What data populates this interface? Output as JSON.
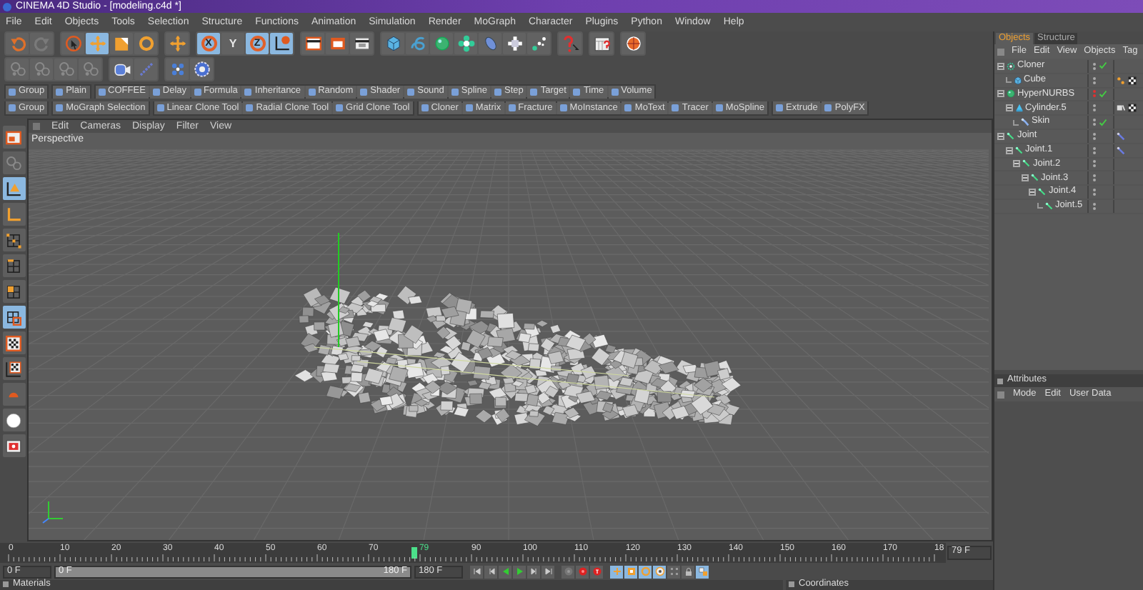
{
  "window": {
    "title": "CINEMA 4D Studio - [modeling.c4d *]"
  },
  "menu": [
    "File",
    "Edit",
    "Objects",
    "Tools",
    "Selection",
    "Structure",
    "Functions",
    "Animation",
    "Simulation",
    "Render",
    "MoGraph",
    "Character",
    "Plugins",
    "Python",
    "Window",
    "Help"
  ],
  "toolbar_rows": [
    [
      [
        {
          "kind": "undo",
          "selected": false
        },
        {
          "kind": "redo",
          "selected": false
        }
      ],
      [
        {
          "kind": "live-select",
          "selected": false
        },
        {
          "kind": "move",
          "selected": true
        },
        {
          "kind": "scale",
          "selected": false
        },
        {
          "kind": "rotate",
          "selected": false
        }
      ],
      [
        {
          "kind": "recent-tool",
          "selected": false
        }
      ],
      [
        {
          "kind": "axis",
          "label": "X",
          "selected": true
        },
        {
          "kind": "axis",
          "label": "Y",
          "selected": false
        },
        {
          "kind": "axis",
          "label": "Z",
          "selected": true
        },
        {
          "kind": "world-coords",
          "selected": true
        }
      ],
      [
        {
          "kind": "render-view",
          "selected": false
        },
        {
          "kind": "render-picture",
          "selected": false
        },
        {
          "kind": "render-settings",
          "selected": false
        }
      ],
      [
        {
          "kind": "cube",
          "selected": false
        },
        {
          "kind": "spline",
          "selected": false
        },
        {
          "kind": "nurbs",
          "selected": false
        },
        {
          "kind": "mograph",
          "selected": false
        },
        {
          "kind": "deformer",
          "selected": false
        },
        {
          "kind": "scene",
          "selected": false
        },
        {
          "kind": "environment",
          "selected": false
        }
      ],
      [
        {
          "kind": "help-cursor",
          "selected": false
        }
      ],
      [
        {
          "kind": "calendar-help",
          "selected": false
        }
      ],
      [
        {
          "kind": "ball",
          "selected": false
        }
      ]
    ],
    [
      [
        {
          "kind": "tool-disabled",
          "selected": false
        },
        {
          "kind": "tool-disabled",
          "selected": false
        },
        {
          "kind": "tool-disabled",
          "selected": false
        },
        {
          "kind": "tool-disabled",
          "selected": false
        }
      ],
      [
        {
          "kind": "camera",
          "selected": false
        },
        {
          "kind": "light-line",
          "selected": false
        }
      ],
      [
        {
          "kind": "cluster",
          "selected": false
        },
        {
          "kind": "gear",
          "selected": false
        }
      ]
    ]
  ],
  "palette_rows": [
    [
      [
        "Group"
      ],
      [
        "Plain"
      ],
      [
        "COFFEE",
        "Delay",
        "Formula",
        "Inheritance",
        "Random",
        "Shader",
        "Sound",
        "Spline",
        "Step",
        "Target",
        "Time",
        "Volume"
      ]
    ],
    [
      [
        "Group"
      ],
      [
        "MoGraph Selection"
      ],
      [
        "Linear Clone Tool",
        "Radial Clone Tool",
        "Grid Clone Tool"
      ],
      [
        "Cloner",
        "Matrix",
        "Fracture",
        "MoInstance",
        "MoText",
        "Tracer",
        "MoSpline"
      ],
      [
        "Extrude",
        "PolyFX"
      ]
    ]
  ],
  "left_toolbar": [
    {
      "kind": "render-region",
      "selected": false
    },
    {
      "kind": "model-disabled",
      "selected": false
    },
    {
      "kind": "object-axis",
      "selected": true
    },
    {
      "kind": "axis-tool",
      "selected": false
    },
    {
      "kind": "points",
      "selected": false
    },
    {
      "kind": "edges",
      "selected": false
    },
    {
      "kind": "polygons",
      "selected": false
    },
    {
      "kind": "uvw",
      "selected": true
    },
    {
      "kind": "texture",
      "selected": false
    },
    {
      "kind": "texture-axis",
      "selected": false
    },
    {
      "kind": "snap",
      "selected": false
    },
    {
      "kind": "light-ball",
      "selected": false
    },
    {
      "kind": "red-window",
      "selected": false
    }
  ],
  "viewport": {
    "menu": [
      "Edit",
      "Cameras",
      "Display",
      "Filter",
      "View"
    ],
    "label": "Perspective"
  },
  "timeline": {
    "ticks_before": [
      "0",
      "10",
      "20",
      "30",
      "40",
      "50",
      "60",
      "70"
    ],
    "ticks_after": [
      "90",
      "100",
      "110",
      "120",
      "130",
      "140",
      "150",
      "160",
      "170",
      "18"
    ],
    "marker": {
      "label": "79",
      "level": 0.439
    },
    "frame_field": "79 F"
  },
  "transport": {
    "start_field": "0 F",
    "range": {
      "start": "0 F",
      "end": "180 F",
      "level": 1
    },
    "end_field": "180 F",
    "buttons": [
      {
        "kind": "go-start"
      },
      {
        "kind": "prev-key"
      },
      {
        "kind": "play-back"
      },
      {
        "kind": "play"
      },
      {
        "kind": "next-key"
      },
      {
        "kind": "go-end"
      }
    ],
    "record": [
      {
        "kind": "record-off"
      },
      {
        "kind": "record"
      },
      {
        "kind": "autokey"
      }
    ],
    "key_tools": [
      {
        "kind": "key-move",
        "selected": true
      },
      {
        "kind": "key-scale",
        "selected": true
      },
      {
        "kind": "key-rotate",
        "selected": true
      },
      {
        "kind": "key-param",
        "selected": true
      },
      {
        "kind": "key-pla",
        "selected": false
      },
      {
        "kind": "key-lock",
        "selected": false
      },
      {
        "kind": "key-all",
        "selected": true
      }
    ]
  },
  "materials": {
    "title": "Materials"
  },
  "coordinates": {
    "title": "Coordinates"
  },
  "object_manager": {
    "tabs": [
      {
        "label": "Objects",
        "selected": true
      },
      {
        "label": "Structure",
        "selected": false
      }
    ],
    "menu": [
      "File",
      "Edit",
      "View",
      "Objects",
      "Tag"
    ],
    "objects": [
      {
        "name": "Cloner",
        "kind": "cloner",
        "expanded": true,
        "hidden": false,
        "enabled": true,
        "children": [
          {
            "name": "Cube",
            "kind": "cube",
            "hidden": false,
            "tags": [
              {
                "kind": "phong"
              },
              {
                "kind": "material"
              }
            ]
          }
        ]
      },
      {
        "name": "HyperNURBS",
        "kind": "nurbs",
        "expanded": true,
        "hidden": true,
        "enabled": true,
        "children": [
          {
            "name": "Cylinder.5",
            "kind": "cylinder",
            "expanded": true,
            "hidden": false,
            "tags": [
              {
                "kind": "fixation"
              },
              {
                "kind": "material"
              }
            ],
            "children": [
              {
                "name": "Skin",
                "kind": "skin",
                "hidden": false,
                "enabled": true
              }
            ]
          }
        ]
      },
      {
        "name": "Joint",
        "kind": "joint",
        "expanded": true,
        "hidden": false,
        "tags": [
          {
            "kind": "ik"
          }
        ],
        "children": [
          {
            "name": "Joint.1",
            "kind": "joint",
            "expanded": true,
            "hidden": false,
            "tags": [
              {
                "kind": "ik"
              }
            ],
            "children": [
              {
                "name": "Joint.2",
                "kind": "joint",
                "expanded": true,
                "hidden": false,
                "children": [
                  {
                    "name": "Joint.3",
                    "kind": "joint",
                    "expanded": true,
                    "hidden": false,
                    "children": [
                      {
                        "name": "Joint.4",
                        "kind": "joint",
                        "expanded": true,
                        "hidden": false,
                        "children": [
                          {
                            "name": "Joint.5",
                            "kind": "joint",
                            "hidden": false
                          }
                        ]
                      }
                    ]
                  }
                ]
              }
            ]
          }
        ]
      }
    ]
  },
  "attributes": {
    "title": "Attributes",
    "menu": [
      "Mode",
      "Edit",
      "User Data"
    ]
  }
}
